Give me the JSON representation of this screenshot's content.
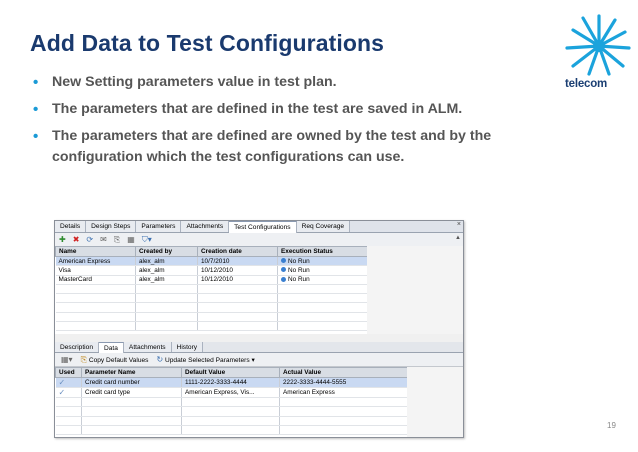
{
  "slide": {
    "title": "Add Data to Test Configurations",
    "bullets": [
      "New Setting parameters value in test plan.",
      "The parameters that are defined in the test are saved in ALM.",
      "The parameters that are defined are owned by the test and by the configuration which the test configurations can use."
    ],
    "logo_text": "telecom",
    "page_number": "19"
  },
  "app": {
    "tabs": [
      "Details",
      "Design Steps",
      "Parameters",
      "Attachments",
      "Test Configurations",
      "Req Coverage"
    ],
    "active_tab": "Test Configurations",
    "config_table": {
      "headers": [
        "Name",
        "Created by",
        "Creation date",
        "Execution Status"
      ],
      "rows": [
        [
          "American Express",
          "alex_alm",
          "10/7/2010",
          "No Run"
        ],
        [
          "Visa",
          "alex_alm",
          "10/12/2010",
          "No Run"
        ],
        [
          "MasterCard",
          "alex_alm",
          "10/12/2010",
          "No Run"
        ]
      ]
    },
    "lower_tabs": [
      "Description",
      "Data",
      "Attachments",
      "History"
    ],
    "lower_active_tab": "Data",
    "data_toolbar": {
      "copy_label": "Copy Default Values",
      "update_label": "Update Selected Parameters"
    },
    "data_table": {
      "headers": [
        "Used",
        "Parameter Name",
        "Default Value",
        "Actual Value"
      ],
      "rows": [
        [
          "",
          "Credit card number",
          "1111-2222-3333-4444",
          "2222-3333-4444-5555"
        ],
        [
          "",
          "Credit card type",
          "American Express, Vis...",
          "American Express"
        ]
      ]
    }
  },
  "colors": {
    "title": "#1a3a6e",
    "bullet": "#1a9ad6",
    "logo": "#1ba3dc",
    "selection": "#c9d9f2"
  }
}
